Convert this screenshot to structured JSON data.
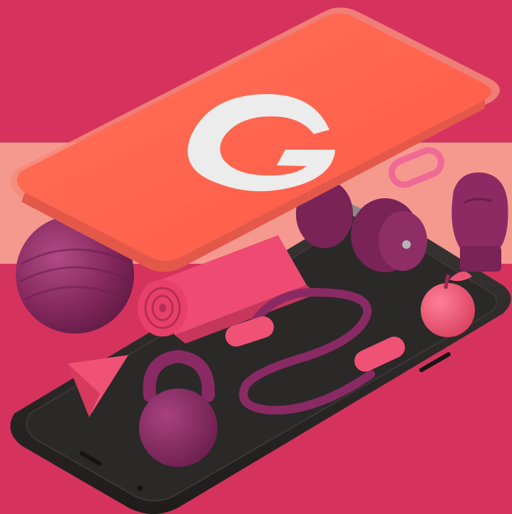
{
  "illustration": {
    "logo_letter": "G",
    "colors": {
      "background": "#d5335e",
      "stripe": "#f5998f",
      "phone_screen": "#ff6450",
      "phone_body": "#2e2a2a",
      "equipment_plum": "#8c2a62",
      "equipment_pink": "#f04e72",
      "logo": "#ececec"
    },
    "objects": [
      "phone-screen-icon",
      "phone-body-icon",
      "exercise-ball-icon",
      "yoga-mat-icon",
      "dumbbell-icon",
      "boxing-glove-icon",
      "carabiner-icon",
      "apple-icon",
      "jump-rope-icon",
      "kettlebell-icon",
      "cone-weight-icon"
    ]
  }
}
